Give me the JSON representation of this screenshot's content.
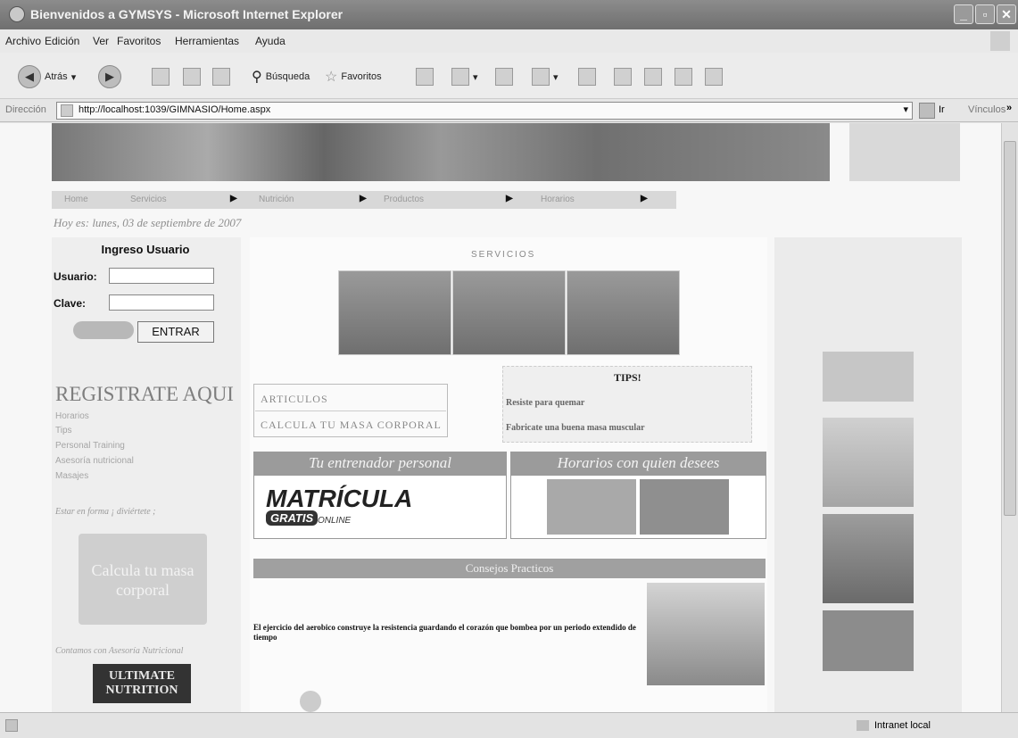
{
  "window": {
    "title": "Bienvenidos a GYMSYS - Microsoft Internet Explorer"
  },
  "menu": [
    "Archivo",
    "Edición",
    "Ver",
    "Favoritos",
    "Herramientas",
    "Ayuda"
  ],
  "toolbar": {
    "back": "Atrás",
    "search": "Búsqueda",
    "favorites": "Favoritos"
  },
  "address": {
    "label": "Dirección",
    "url": "http://localhost:1039/GIMNASIO/Home.aspx",
    "go": "Ir",
    "links": "Vínculos"
  },
  "nav": [
    "Home",
    "Servicios",
    "Nutrición",
    "Productos",
    "Horarios"
  ],
  "date_text": "Hoy es: lunes, 03 de septiembre de 2007",
  "login": {
    "title": "Ingreso Usuario",
    "user_label": "Usuario:",
    "pass_label": "Clave:",
    "button": "ENTRAR"
  },
  "left": {
    "register": "REGISTRATE AQUI",
    "links": [
      "Horarios",
      "Tips",
      "Personal Training",
      "Asesoría nutricional",
      "Masajes"
    ],
    "tagline": "Estar en forma ¡ diviértete ;",
    "calc_image_text": "Calcula tu masa corporal",
    "advisor": "Contamos con Asesoría Nutricional",
    "brand": "ULTIMATE NUTRITION"
  },
  "center": {
    "services_title": "SERVICIOS",
    "articles": [
      "ARTICULOS",
      "CALCULA TU MASA CORPORAL"
    ],
    "tips_title": "TIPS!",
    "tips": [
      "Resiste para quemar",
      "Fabricate una buena masa muscular"
    ],
    "banner_left": "Tu entrenador personal",
    "banner_right": "Horarios con quien desees",
    "matricula": "MATRÍCULA",
    "gratis": "GRATIS",
    "online": "ONLINE",
    "consejos": "Consejos Practicos",
    "exercise_text": "El ejercicio del aerobico construye la resistencia guardando el corazón que bombea por un periodo extendido de tiempo"
  },
  "status": {
    "zone": "Intranet local"
  }
}
